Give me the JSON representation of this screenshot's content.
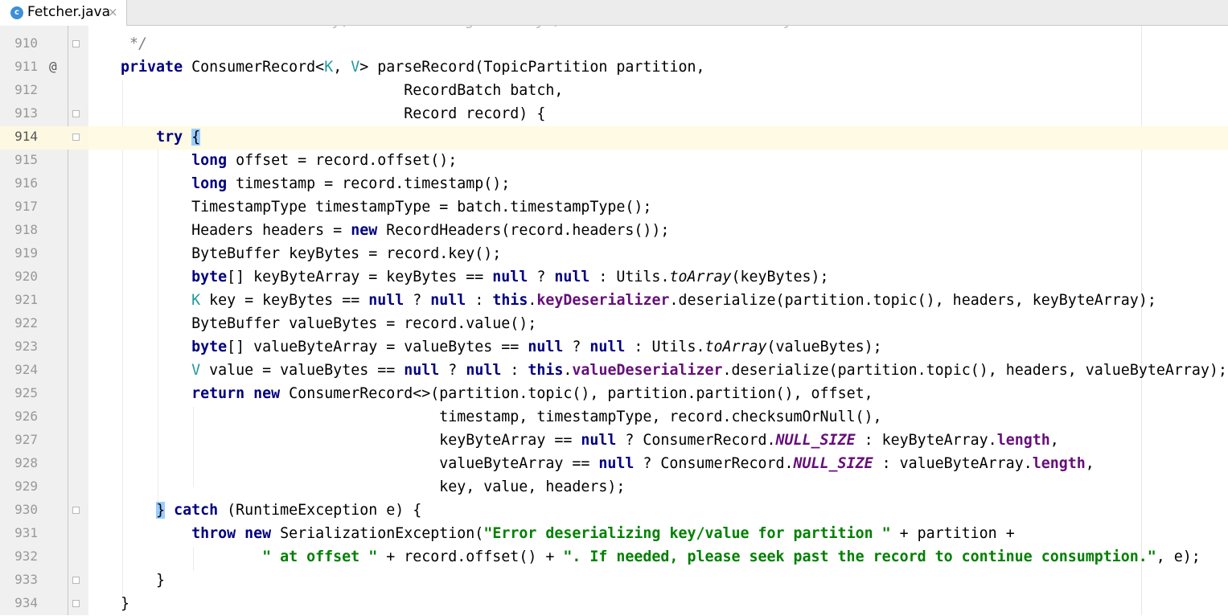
{
  "tab": {
    "icon": "c",
    "title": "Fetcher.java",
    "close": "×"
  },
  "lines": [
    {
      "n": "910",
      "current": false,
      "marker": "",
      "fold": true,
      "segs": [
        [
          "cmt",
          "     */"
        ]
      ]
    },
    {
      "n": "911",
      "current": false,
      "marker": "@",
      "fold": false,
      "segs": [
        [
          "",
          "    "
        ],
        [
          "kw",
          "private"
        ],
        [
          "",
          " ConsumerRecord<"
        ],
        [
          "tp",
          "K"
        ],
        [
          "",
          ", "
        ],
        [
          "tp",
          "V"
        ],
        [
          "",
          "> parseRecord(TopicPartition partition,"
        ]
      ]
    },
    {
      "n": "912",
      "current": false,
      "marker": "",
      "fold": false,
      "segs": [
        [
          "",
          "                                    RecordBatch batch,"
        ]
      ]
    },
    {
      "n": "913",
      "current": false,
      "marker": "",
      "fold": true,
      "segs": [
        [
          "",
          "                                    Record record) {"
        ]
      ]
    },
    {
      "n": "914",
      "current": true,
      "marker": "",
      "fold": true,
      "segs": [
        [
          "",
          "        "
        ],
        [
          "kw",
          "try"
        ],
        [
          "",
          " "
        ],
        [
          "brace",
          "{"
        ]
      ]
    },
    {
      "n": "915",
      "current": false,
      "marker": "",
      "fold": false,
      "segs": [
        [
          "",
          "            "
        ],
        [
          "kw",
          "long"
        ],
        [
          "",
          " offset = record.offset();"
        ]
      ]
    },
    {
      "n": "916",
      "current": false,
      "marker": "",
      "fold": false,
      "segs": [
        [
          "",
          "            "
        ],
        [
          "kw",
          "long"
        ],
        [
          "",
          " timestamp = record.timestamp();"
        ]
      ]
    },
    {
      "n": "917",
      "current": false,
      "marker": "",
      "fold": false,
      "segs": [
        [
          "",
          "            TimestampType timestampType = batch.timestampType();"
        ]
      ]
    },
    {
      "n": "918",
      "current": false,
      "marker": "",
      "fold": false,
      "segs": [
        [
          "",
          "            Headers headers = "
        ],
        [
          "kw",
          "new"
        ],
        [
          "",
          " RecordHeaders(record.headers());"
        ]
      ]
    },
    {
      "n": "919",
      "current": false,
      "marker": "",
      "fold": false,
      "segs": [
        [
          "",
          "            ByteBuffer keyBytes = record.key();"
        ]
      ]
    },
    {
      "n": "920",
      "current": false,
      "marker": "",
      "fold": false,
      "segs": [
        [
          "",
          "            "
        ],
        [
          "kw",
          "byte"
        ],
        [
          "",
          "[] keyByteArray = keyBytes == "
        ],
        [
          "kw",
          "null"
        ],
        [
          "",
          " ? "
        ],
        [
          "kw",
          "null"
        ],
        [
          "",
          " : Utils."
        ],
        [
          "smeth",
          "toArray"
        ],
        [
          "",
          "(keyBytes);"
        ]
      ]
    },
    {
      "n": "921",
      "current": false,
      "marker": "",
      "fold": false,
      "segs": [
        [
          "",
          "            "
        ],
        [
          "tp",
          "K"
        ],
        [
          "",
          " key = keyBytes == "
        ],
        [
          "kw",
          "null"
        ],
        [
          "",
          " ? "
        ],
        [
          "kw",
          "null"
        ],
        [
          "",
          " : "
        ],
        [
          "kw",
          "this"
        ],
        [
          "",
          "."
        ],
        [
          "fld",
          "keyDeserializer"
        ],
        [
          "",
          ".deserialize(partition.topic(), headers, keyByteArray);"
        ]
      ]
    },
    {
      "n": "922",
      "current": false,
      "marker": "",
      "fold": false,
      "segs": [
        [
          "",
          "            ByteBuffer valueBytes = record.value();"
        ]
      ]
    },
    {
      "n": "923",
      "current": false,
      "marker": "",
      "fold": false,
      "segs": [
        [
          "",
          "            "
        ],
        [
          "kw",
          "byte"
        ],
        [
          "",
          "[] valueByteArray = valueBytes == "
        ],
        [
          "kw",
          "null"
        ],
        [
          "",
          " ? "
        ],
        [
          "kw",
          "null"
        ],
        [
          "",
          " : Utils."
        ],
        [
          "smeth",
          "toArray"
        ],
        [
          "",
          "(valueBytes);"
        ]
      ]
    },
    {
      "n": "924",
      "current": false,
      "marker": "",
      "fold": false,
      "segs": [
        [
          "",
          "            "
        ],
        [
          "tp",
          "V"
        ],
        [
          "",
          " value = valueBytes == "
        ],
        [
          "kw",
          "null"
        ],
        [
          "",
          " ? "
        ],
        [
          "kw",
          "null"
        ],
        [
          "",
          " : "
        ],
        [
          "kw",
          "this"
        ],
        [
          "",
          "."
        ],
        [
          "fld",
          "valueDeserializer"
        ],
        [
          "",
          ".deserialize(partition.topic(), headers, valueByteArray);"
        ]
      ]
    },
    {
      "n": "925",
      "current": false,
      "marker": "",
      "fold": false,
      "segs": [
        [
          "",
          "            "
        ],
        [
          "kw",
          "return"
        ],
        [
          "",
          " "
        ],
        [
          "kw",
          "new"
        ],
        [
          "",
          " ConsumerRecord<>(partition.topic(), partition.partition(), offset,"
        ]
      ]
    },
    {
      "n": "926",
      "current": false,
      "marker": "",
      "fold": false,
      "segs": [
        [
          "",
          "                                        timestamp, timestampType, record.checksumOrNull(),"
        ]
      ]
    },
    {
      "n": "927",
      "current": false,
      "marker": "",
      "fold": false,
      "segs": [
        [
          "",
          "                                        keyByteArray == "
        ],
        [
          "kw",
          "null"
        ],
        [
          "",
          " ? ConsumerRecord."
        ],
        [
          "sfld",
          "NULL_SIZE"
        ],
        [
          "",
          " : keyByteArray."
        ],
        [
          "fld",
          "length"
        ],
        [
          "",
          ","
        ]
      ]
    },
    {
      "n": "928",
      "current": false,
      "marker": "",
      "fold": false,
      "segs": [
        [
          "",
          "                                        valueByteArray == "
        ],
        [
          "kw",
          "null"
        ],
        [
          "",
          " ? ConsumerRecord."
        ],
        [
          "sfld",
          "NULL_SIZE"
        ],
        [
          "",
          " : valueByteArray."
        ],
        [
          "fld",
          "length"
        ],
        [
          "",
          ","
        ]
      ]
    },
    {
      "n": "929",
      "current": false,
      "marker": "",
      "fold": false,
      "segs": [
        [
          "",
          "                                        key, value, headers);"
        ]
      ]
    },
    {
      "n": "930",
      "current": false,
      "marker": "",
      "fold": true,
      "segs": [
        [
          "",
          "        "
        ],
        [
          "brace",
          "}"
        ],
        [
          "",
          " "
        ],
        [
          "kw",
          "catch"
        ],
        [
          "",
          " (RuntimeException e) {"
        ]
      ]
    },
    {
      "n": "931",
      "current": false,
      "marker": "",
      "fold": false,
      "segs": [
        [
          "",
          "            "
        ],
        [
          "kw",
          "throw"
        ],
        [
          "",
          " "
        ],
        [
          "kw",
          "new"
        ],
        [
          "",
          " SerializationException("
        ],
        [
          "str",
          "\"Error deserializing key/value for partition \""
        ],
        [
          "",
          " + partition +"
        ]
      ]
    },
    {
      "n": "932",
      "current": false,
      "marker": "",
      "fold": false,
      "segs": [
        [
          "",
          "                    "
        ],
        [
          "str",
          "\" at offset \""
        ],
        [
          "",
          " + record.offset() + "
        ],
        [
          "str",
          "\". If needed, please seek past the record to continue consumption.\""
        ],
        [
          "",
          ", e);"
        ]
      ]
    },
    {
      "n": "933",
      "current": false,
      "marker": "",
      "fold": true,
      "segs": [
        [
          "",
          "        }"
        ]
      ]
    },
    {
      "n": "934",
      "current": false,
      "marker": "",
      "fold": true,
      "segs": [
        [
          "",
          "    }"
        ]
      ]
    }
  ],
  "colors": {
    "keyword": "#000080",
    "type_param": "#20999d",
    "field": "#660e7a",
    "string": "#008000",
    "comment": "#808080",
    "current_line": "#fffae3",
    "gutter": "#f0f0f0"
  }
}
